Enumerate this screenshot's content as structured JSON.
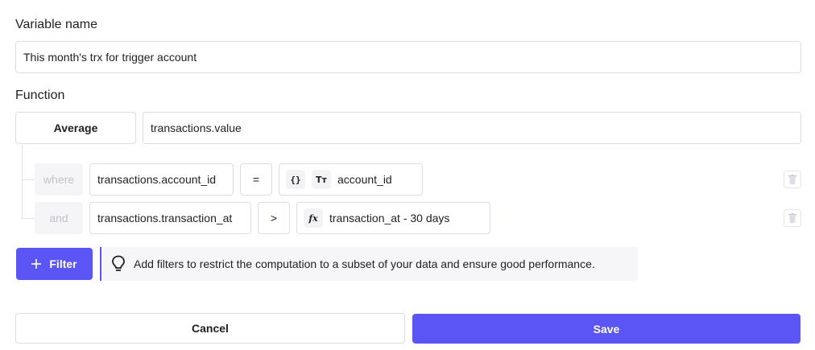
{
  "variable": {
    "label": "Variable name",
    "value": "This month's trx for trigger account"
  },
  "function": {
    "label": "Function",
    "aggregation": "Average",
    "field": "transactions.value"
  },
  "filters": [
    {
      "connector": "where",
      "field": "transactions.account_id",
      "operator": "=",
      "value_icons": [
        "{}",
        "Tт"
      ],
      "value": "account_id"
    },
    {
      "connector": "and",
      "field": "transactions.transaction_at",
      "operator": ">",
      "value_icons": [
        "fx"
      ],
      "value": "transaction_at - 30 days"
    }
  ],
  "actions": {
    "filter_label": "Filter",
    "hint": "Add filters to restrict the computation to a subset of your data and ensure good performance.",
    "cancel_label": "Cancel",
    "save_label": "Save"
  },
  "colors": {
    "primary": "#5b55f5",
    "border": "#dcdce2",
    "muted_text": "#c2c2ca"
  },
  "icons": {
    "plus": "plus-icon",
    "bulb": "lightbulb-icon",
    "trash": "trash-icon",
    "braces": "braces-icon",
    "text_type": "text-type-icon",
    "function": "function-icon"
  }
}
